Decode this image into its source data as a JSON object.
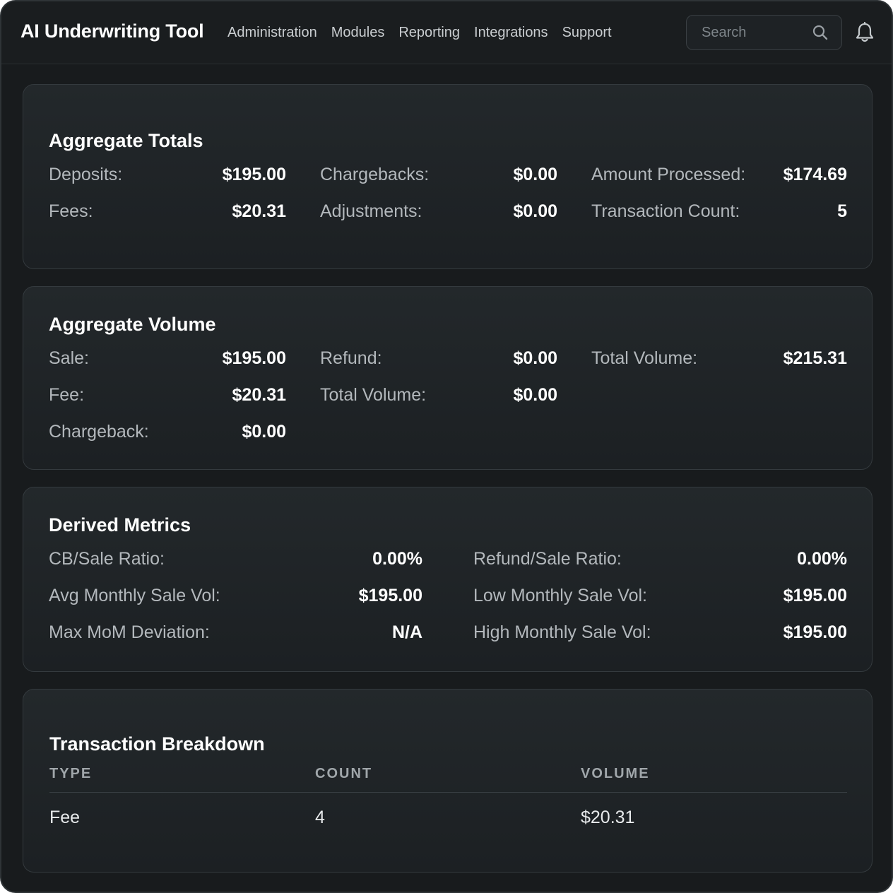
{
  "header": {
    "title": "AI Underwriting Tool",
    "nav": [
      "Administration",
      "Modules",
      "Reporting",
      "Integrations",
      "Support"
    ],
    "search_placeholder": "Search"
  },
  "aggregate_totals": {
    "title": "Aggregate Totals",
    "deposits": {
      "label": "Deposits:",
      "value": "$195.00"
    },
    "fees": {
      "label": "Fees:",
      "value": "$20.31"
    },
    "chargebacks": {
      "label": "Chargebacks:",
      "value": "$0.00"
    },
    "adjustments": {
      "label": "Adjustments:",
      "value": "$0.00"
    },
    "amount_processed": {
      "label": "Amount Processed:",
      "value": "$174.69"
    },
    "transaction_count": {
      "label": "Transaction Count:",
      "value": "5"
    }
  },
  "aggregate_volume": {
    "title": "Aggregate Volume",
    "sale": {
      "label": "Sale:",
      "value": "$195.00"
    },
    "fee": {
      "label": "Fee:",
      "value": "$20.31"
    },
    "chargeback": {
      "label": "Chargeback:",
      "value": "$0.00"
    },
    "refund": {
      "label": "Refund:",
      "value": "$0.00"
    },
    "total_volume_mid": {
      "label": "Total Volume:",
      "value": "$0.00"
    },
    "total_volume": {
      "label": "Total Volume:",
      "value": "$215.31"
    }
  },
  "derived_metrics": {
    "title": "Derived Metrics",
    "cb_sale_ratio": {
      "label": "CB/Sale Ratio:",
      "value": "0.00%"
    },
    "avg_monthly_sale_vol": {
      "label": "Avg Monthly Sale Vol:",
      "value": "$195.00"
    },
    "max_mom_deviation": {
      "label": "Max MoM Deviation:",
      "value": "N/A"
    },
    "refund_sale_ratio": {
      "label": "Refund/Sale Ratio:",
      "value": "0.00%"
    },
    "low_monthly_sale_vol": {
      "label": "Low Monthly Sale Vol:",
      "value": "$195.00"
    },
    "high_monthly_sale_vol": {
      "label": "High Monthly Sale Vol:",
      "value": "$195.00"
    }
  },
  "transaction_breakdown": {
    "title": "Transaction Breakdown",
    "columns": [
      "TYPE",
      "COUNT",
      "VOLUME"
    ],
    "rows": [
      {
        "type": "Fee",
        "count": "4",
        "volume": "$20.31"
      }
    ]
  },
  "theme": {
    "background": "#181b1d",
    "card": "#23282b",
    "text": "#ffffff",
    "muted": "#b3b8bc"
  }
}
